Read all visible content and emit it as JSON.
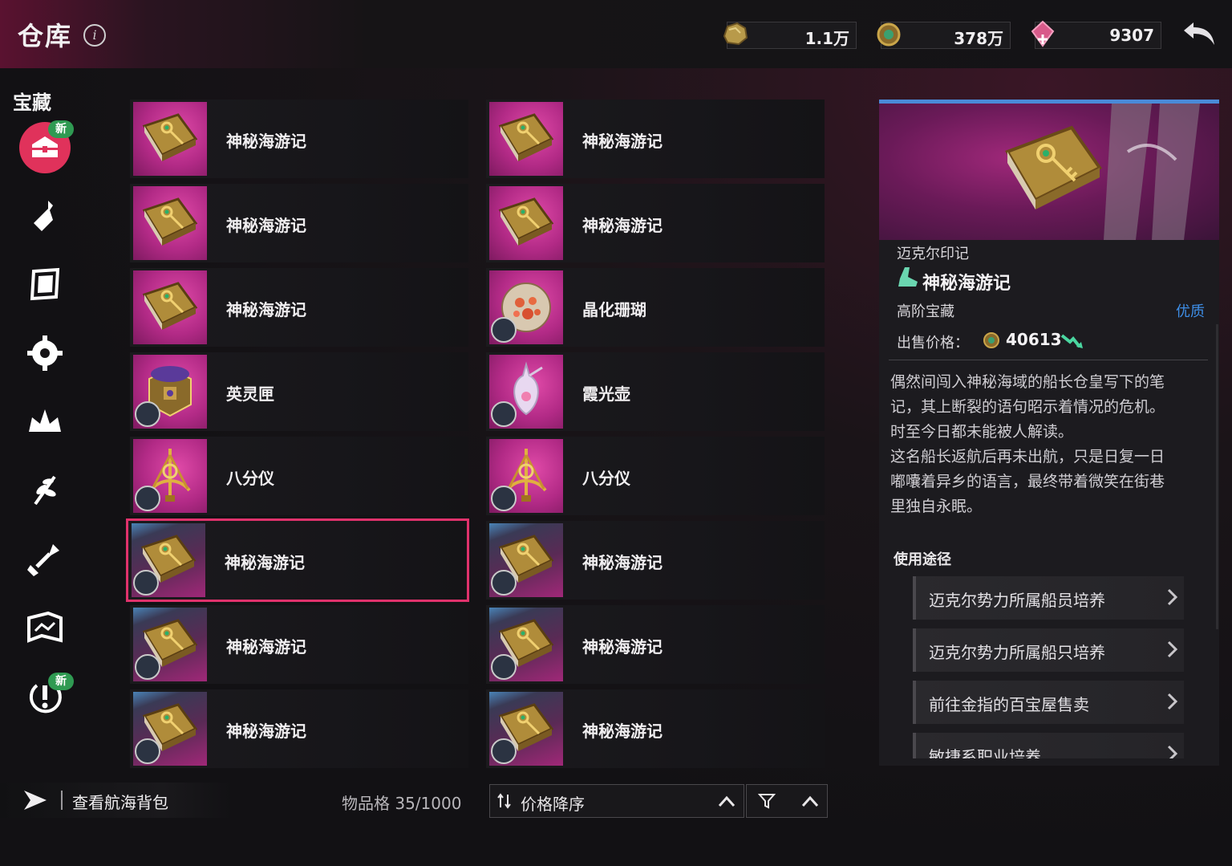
{
  "header": {
    "title": "仓库",
    "info_icon": "info-icon",
    "currencies": [
      {
        "icon": "gold-ore-icon",
        "value": "1.1万"
      },
      {
        "icon": "coin-pouch-icon",
        "value": "378万"
      },
      {
        "icon": "pink-gem-icon",
        "value": "9307"
      }
    ],
    "back_icon": "back-arrow-icon"
  },
  "sidebar": {
    "title": "宝藏",
    "items": [
      {
        "icon": "treasure-chest-icon",
        "active": true,
        "badge": "新"
      },
      {
        "icon": "bottle-icon"
      },
      {
        "icon": "scroll-frame-icon"
      },
      {
        "icon": "gear-flower-icon"
      },
      {
        "icon": "crown-icon"
      },
      {
        "icon": "herb-icon"
      },
      {
        "icon": "shovel-icon"
      },
      {
        "icon": "map-icon"
      },
      {
        "icon": "alert-icon",
        "badge": "新"
      }
    ]
  },
  "grid": {
    "items": [
      {
        "name": "神秘海游记",
        "bg": "pink",
        "art": "book",
        "badge": false
      },
      {
        "name": "神秘海游记",
        "bg": "pink",
        "art": "book",
        "badge": false
      },
      {
        "name": "神秘海游记",
        "bg": "pink",
        "art": "book",
        "badge": false
      },
      {
        "name": "神秘海游记",
        "bg": "pink",
        "art": "book",
        "badge": false
      },
      {
        "name": "神秘海游记",
        "bg": "pink",
        "art": "book",
        "badge": false
      },
      {
        "name": "晶化珊瑚",
        "bg": "pink",
        "art": "coral",
        "badge": true
      },
      {
        "name": "英灵匣",
        "bg": "pink",
        "art": "box",
        "badge": true
      },
      {
        "name": "霞光壶",
        "bg": "pink",
        "art": "vase",
        "badge": true
      },
      {
        "name": "八分仪",
        "bg": "pink",
        "art": "octant",
        "badge": true
      },
      {
        "name": "八分仪",
        "bg": "pink",
        "art": "octant",
        "badge": true
      },
      {
        "name": "神秘海游记",
        "bg": "blue",
        "art": "book",
        "badge": true,
        "selected": true
      },
      {
        "name": "神秘海游记",
        "bg": "blue",
        "art": "book",
        "badge": true
      },
      {
        "name": "神秘海游记",
        "bg": "blue",
        "art": "book",
        "badge": true
      },
      {
        "name": "神秘海游记",
        "bg": "blue",
        "art": "book",
        "badge": true
      },
      {
        "name": "神秘海游记",
        "bg": "blue",
        "art": "book",
        "badge": true
      },
      {
        "name": "神秘海游记",
        "bg": "blue",
        "art": "book",
        "badge": true
      }
    ]
  },
  "footer": {
    "bag_label": "查看航海背包",
    "slot_count": "物品格 35/1000",
    "sort_label": "价格降序"
  },
  "detail": {
    "faction": "迈克尔印记",
    "name": "神秘海游记",
    "tier": "高阶宝藏",
    "quality": "优质",
    "price_label": "出售价格：",
    "price_value": "40613",
    "description": [
      "偶然间闯入神秘海域的船长仓皇写下的笔",
      "记，其上断裂的语句昭示着情况的危机。",
      "时至今日都未能被人解读。",
      "这名船长返航后再未出航，只是日复一日",
      "嘟囔着异乡的语言，最终带着微笑在街巷",
      "里独自永眠。"
    ],
    "usage_title": "使用途径",
    "usages": [
      "迈克尔势力所属船员培养",
      "迈克尔势力所属船只培养",
      "前往金指的百宝屋售卖",
      "敏捷系职业培养"
    ]
  },
  "colors": {
    "accent": "#e0326c",
    "quality_blue": "#3e8fe8",
    "badge_green": "#2f9a52"
  }
}
